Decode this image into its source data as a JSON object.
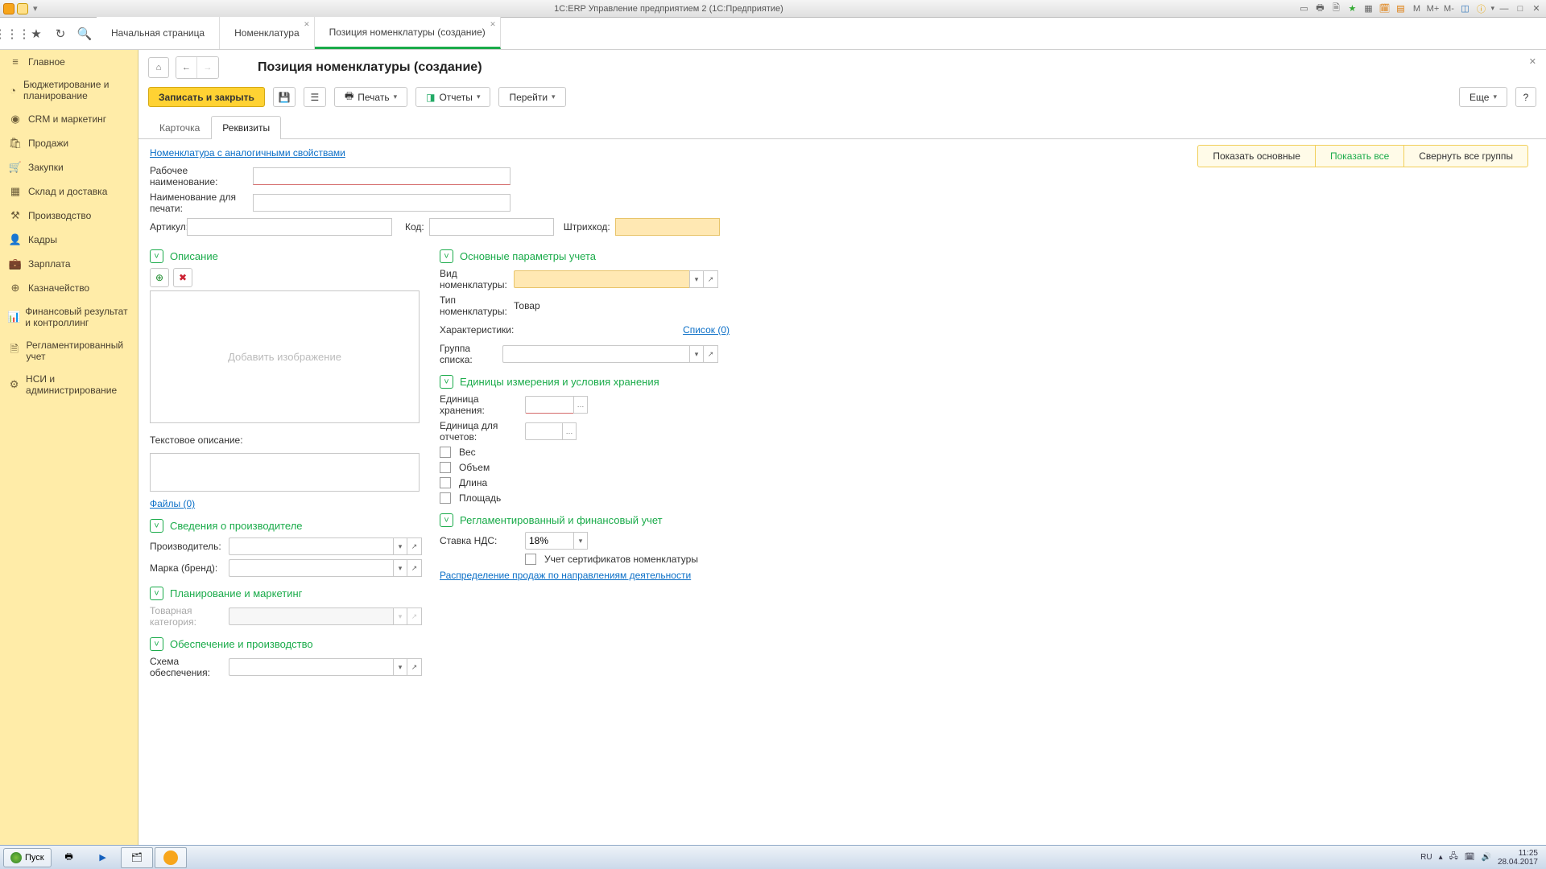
{
  "window": {
    "title": "1С:ERP Управление предприятием 2   (1С:Предприятие)"
  },
  "topIcons": [
    "M",
    "M+",
    "M-"
  ],
  "toolbarTabs": {
    "t0": "Начальная страница",
    "t1": "Номенклатура",
    "t2": "Позиция номенклатуры (создание)"
  },
  "sidebar": {
    "items": [
      {
        "icon": "≡",
        "label": "Главное"
      },
      {
        "icon": "◔",
        "label": "Бюджетирование и планирование"
      },
      {
        "icon": "●",
        "label": "CRM и маркетинг"
      },
      {
        "icon": "🛍",
        "label": "Продажи"
      },
      {
        "icon": "🛒",
        "label": "Закупки"
      },
      {
        "icon": "▦",
        "label": "Склад и доставка"
      },
      {
        "icon": "⚒",
        "label": "Производство"
      },
      {
        "icon": "👤",
        "label": "Кадры"
      },
      {
        "icon": "💼",
        "label": "Зарплата"
      },
      {
        "icon": "⊕",
        "label": "Казначейство"
      },
      {
        "icon": "📊",
        "label": "Финансовый результат и контроллинг"
      },
      {
        "icon": "🗎",
        "label": "Регламентированный учет"
      },
      {
        "icon": "⚙",
        "label": "НСИ и администрирование"
      }
    ]
  },
  "page": {
    "title": "Позиция номенклатуры (создание)",
    "saveClose": "Записать и закрыть",
    "print": "Печать",
    "reports": "Отчеты",
    "goto": "Перейти",
    "more": "Еще",
    "help": "?"
  },
  "subtabs": {
    "card": "Карточка",
    "props": "Реквизиты"
  },
  "modePills": {
    "main": "Показать основные",
    "all": "Показать все",
    "collapse": "Свернуть все группы"
  },
  "topLink": "Номенклатура с аналогичными свойствами",
  "fields": {
    "workName": "Рабочее наименование:",
    "printName": "Наименование для печати:",
    "article": "Артикул:",
    "code": "Код:",
    "barcode": "Штрихкод:",
    "textDesc": "Текстовое описание:",
    "files": "Файлы (0)",
    "manufacturer": "Производитель:",
    "brand": "Марка (бренд):",
    "category": "Товарная категория:",
    "supplyScheme": "Схема обеспечения:",
    "kind": "Вид номенклатуры:",
    "typeLabel": "Тип номенклатуры:",
    "typeValue": "Товар",
    "characteristics": "Характеристики:",
    "charLink": "Список (0)",
    "listGroup": "Группа списка:",
    "storeUnit": "Единица хранения:",
    "reportUnit": "Единица для отчетов:",
    "chkWeight": "Вес",
    "chkVolume": "Объем",
    "chkLength": "Длина",
    "chkArea": "Площадь",
    "vatLabel": "Ставка НДС:",
    "vatValue": "18%",
    "certAccounting": "Учет сертификатов номенклатуры",
    "salesDistribution": "Распределение продаж по направлениям деятельности",
    "addImage": "Добавить изображение"
  },
  "sections": {
    "desc": "Описание",
    "accounting": "Основные параметры учета",
    "units": "Единицы измерения и условия хранения",
    "regulated": "Регламентированный и финансовый учет",
    "producer": "Сведения о производителе",
    "planning": "Планирование и маркетинг",
    "supply": "Обеспечение и производство"
  },
  "taskbar": {
    "start": "Пуск",
    "lang": "RU",
    "time": "11:25",
    "date": "28.04.2017"
  }
}
